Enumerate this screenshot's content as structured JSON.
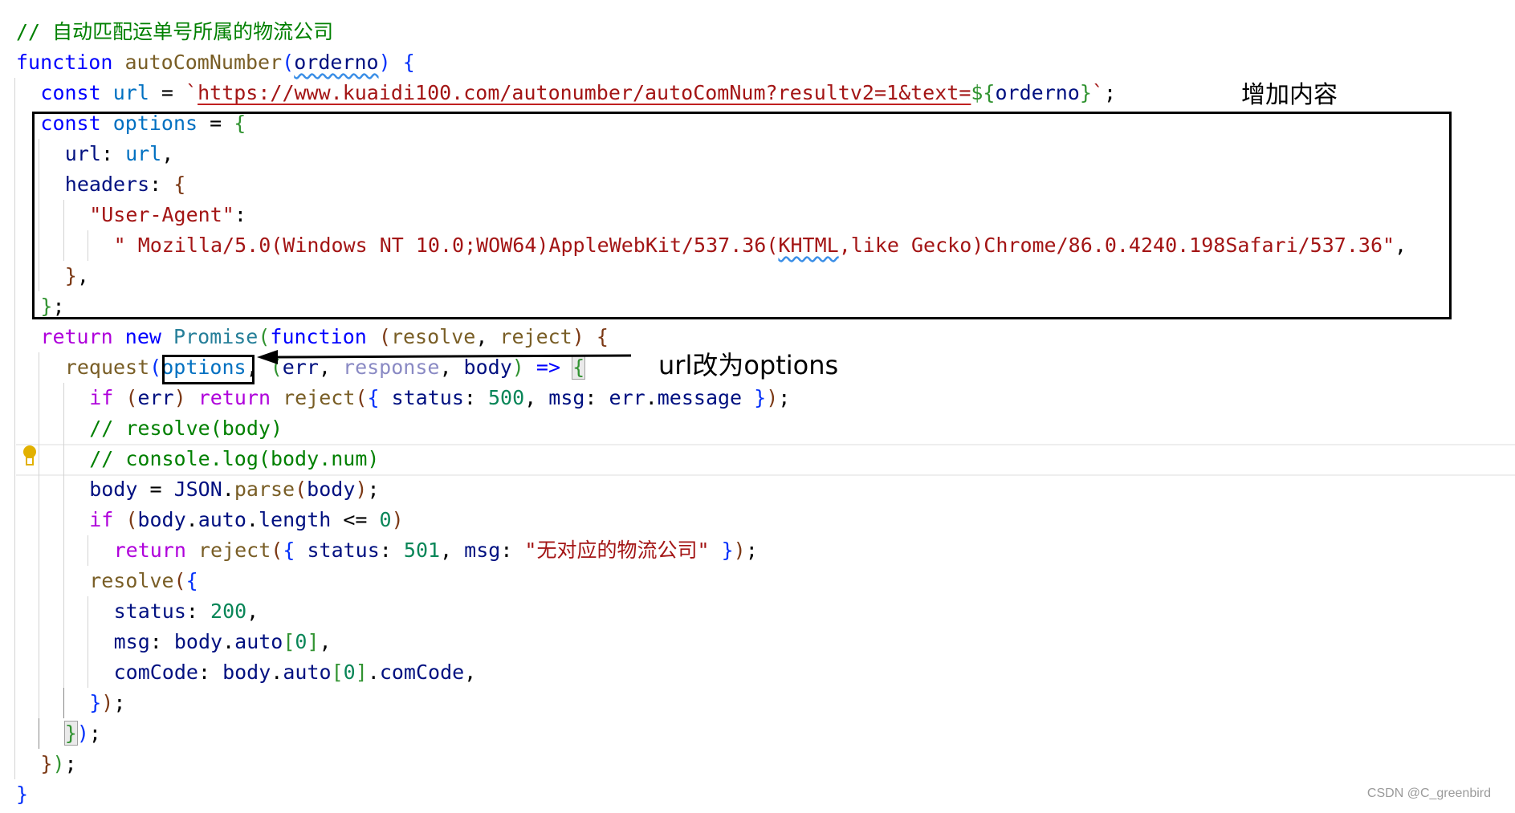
{
  "annotations": {
    "added_content": "增加内容",
    "url_changed": "url改为options"
  },
  "watermark": "CSDN @C_greenbird",
  "icons": {
    "gutter": "lightbulb-icon",
    "arrow": "arrow-left-icon"
  },
  "code": [
    {
      "i": 0,
      "t": [
        [
          "// 自动匹配运单号所属的物流公司",
          "com"
        ]
      ]
    },
    {
      "i": 0,
      "t": [
        [
          "function",
          "kw"
        ],
        [
          " ",
          "pl"
        ],
        [
          "autoComNumber",
          "fn"
        ],
        [
          "(",
          "b1"
        ],
        [
          "orderno",
          "var wavy"
        ],
        [
          ")",
          "b1"
        ],
        [
          " ",
          "pl"
        ],
        [
          "{",
          "b1"
        ]
      ]
    },
    {
      "i": 1,
      "t": [
        [
          "const",
          "kw"
        ],
        [
          " ",
          "pl"
        ],
        [
          "url",
          "opt"
        ],
        [
          " = ",
          "pl"
        ],
        [
          "`",
          "str"
        ],
        [
          "https://www.kuaidi100.com/autonumber/autoComNum?resultv2=1&text=",
          "str redline"
        ],
        [
          "${",
          "b2"
        ],
        [
          "orderno",
          "var"
        ],
        [
          "}",
          "b2"
        ],
        [
          "`",
          "str"
        ],
        [
          ";",
          "pl"
        ]
      ]
    },
    {
      "i": 1,
      "t": [
        [
          "const",
          "kw"
        ],
        [
          " ",
          "pl"
        ],
        [
          "options",
          "opt"
        ],
        [
          " = ",
          "pl"
        ],
        [
          "{",
          "b2"
        ]
      ]
    },
    {
      "i": 2,
      "t": [
        [
          "url",
          "var"
        ],
        [
          ": ",
          "pl"
        ],
        [
          "url",
          "opt"
        ],
        [
          ",",
          "pl"
        ]
      ]
    },
    {
      "i": 2,
      "t": [
        [
          "headers",
          "var"
        ],
        [
          ": ",
          "pl"
        ],
        [
          "{",
          "b3"
        ]
      ]
    },
    {
      "i": 3,
      "t": [
        [
          "\"User-Agent\"",
          "str"
        ],
        [
          ":",
          "pl"
        ]
      ]
    },
    {
      "i": 4,
      "t": [
        [
          "\" Mozilla/5.0(Windows NT 10.0;WOW64)AppleWebKit/537.36(",
          "str"
        ],
        [
          "KHTML",
          "str wavy"
        ],
        [
          ",like Gecko)Chrome/86.0.4240.198Safari/537.36\"",
          "str"
        ],
        [
          ",",
          "pl"
        ]
      ]
    },
    {
      "i": 2,
      "t": [
        [
          "}",
          "b3"
        ],
        [
          ",",
          "pl"
        ]
      ]
    },
    {
      "i": 1,
      "t": [
        [
          "}",
          "b2"
        ],
        [
          ";",
          "pl"
        ]
      ]
    },
    {
      "i": 1,
      "t": [
        [
          "return",
          "ctl"
        ],
        [
          " ",
          "pl"
        ],
        [
          "new",
          "kw"
        ],
        [
          " ",
          "pl"
        ],
        [
          "Promise",
          "type"
        ],
        [
          "(",
          "b2"
        ],
        [
          "function",
          "kw"
        ],
        [
          " ",
          "pl"
        ],
        [
          "(",
          "b3"
        ],
        [
          "resolve",
          "fn"
        ],
        [
          ", ",
          "pl"
        ],
        [
          "reject",
          "fn"
        ],
        [
          ")",
          "b3"
        ],
        [
          " ",
          "pl"
        ],
        [
          "{",
          "b3"
        ]
      ]
    },
    {
      "i": 2,
      "t": [
        [
          "request",
          "fn"
        ],
        [
          "(",
          "b1"
        ],
        [
          "options",
          "opt"
        ],
        [
          ", ",
          "pl"
        ],
        [
          "(",
          "b2"
        ],
        [
          "err",
          "var"
        ],
        [
          ", ",
          "pl"
        ],
        [
          "response",
          "muted"
        ],
        [
          ", ",
          "pl"
        ],
        [
          "body",
          "var"
        ],
        [
          ")",
          "b2"
        ],
        [
          " ",
          "pl"
        ],
        [
          "=>",
          "kw"
        ],
        [
          " ",
          "pl"
        ],
        [
          "{",
          "b2 bracket-box"
        ]
      ]
    },
    {
      "i": 3,
      "t": [
        [
          "if",
          "ctl"
        ],
        [
          " ",
          "pl"
        ],
        [
          "(",
          "b3"
        ],
        [
          "err",
          "var"
        ],
        [
          ")",
          "b3"
        ],
        [
          " ",
          "pl"
        ],
        [
          "return",
          "ctl"
        ],
        [
          " ",
          "pl"
        ],
        [
          "reject",
          "fn"
        ],
        [
          "(",
          "b3"
        ],
        [
          "{",
          "b1"
        ],
        [
          " ",
          "pl"
        ],
        [
          "status",
          "var"
        ],
        [
          ": ",
          "pl"
        ],
        [
          "500",
          "num"
        ],
        [
          ", ",
          "pl"
        ],
        [
          "msg",
          "var"
        ],
        [
          ": ",
          "pl"
        ],
        [
          "err",
          "var"
        ],
        [
          ".",
          "pl"
        ],
        [
          "message",
          "var"
        ],
        [
          " ",
          "pl"
        ],
        [
          "}",
          "b1"
        ],
        [
          ")",
          "b3"
        ],
        [
          ";",
          "pl"
        ]
      ]
    },
    {
      "i": 3,
      "t": [
        [
          "// resolve(body)",
          "com"
        ]
      ]
    },
    {
      "i": 3,
      "t": [
        [
          "// console.log(body.num)",
          "com"
        ]
      ]
    },
    {
      "i": 3,
      "t": [
        [
          "body",
          "var"
        ],
        [
          " = ",
          "pl"
        ],
        [
          "JSON",
          "var"
        ],
        [
          ".",
          "pl"
        ],
        [
          "parse",
          "fn"
        ],
        [
          "(",
          "b3"
        ],
        [
          "body",
          "var"
        ],
        [
          ")",
          "b3"
        ],
        [
          ";",
          "pl"
        ]
      ]
    },
    {
      "i": 3,
      "t": [
        [
          "if",
          "ctl"
        ],
        [
          " ",
          "pl"
        ],
        [
          "(",
          "b3"
        ],
        [
          "body",
          "var"
        ],
        [
          ".",
          "pl"
        ],
        [
          "auto",
          "var"
        ],
        [
          ".",
          "pl"
        ],
        [
          "length",
          "var"
        ],
        [
          " <= ",
          "pl"
        ],
        [
          "0",
          "num"
        ],
        [
          ")",
          "b3"
        ]
      ]
    },
    {
      "i": 4,
      "t": [
        [
          "return",
          "ctl"
        ],
        [
          " ",
          "pl"
        ],
        [
          "reject",
          "fn"
        ],
        [
          "(",
          "b3"
        ],
        [
          "{",
          "b1"
        ],
        [
          " ",
          "pl"
        ],
        [
          "status",
          "var"
        ],
        [
          ": ",
          "pl"
        ],
        [
          "501",
          "num"
        ],
        [
          ", ",
          "pl"
        ],
        [
          "msg",
          "var"
        ],
        [
          ": ",
          "pl"
        ],
        [
          "\"无对应的物流公司\"",
          "str"
        ],
        [
          " ",
          "pl"
        ],
        [
          "}",
          "b1"
        ],
        [
          ")",
          "b3"
        ],
        [
          ";",
          "pl"
        ]
      ]
    },
    {
      "i": 3,
      "t": [
        [
          "resolve",
          "fn"
        ],
        [
          "(",
          "b3"
        ],
        [
          "{",
          "b1"
        ]
      ]
    },
    {
      "i": 4,
      "t": [
        [
          "status",
          "var"
        ],
        [
          ": ",
          "pl"
        ],
        [
          "200",
          "num"
        ],
        [
          ",",
          "pl"
        ]
      ]
    },
    {
      "i": 4,
      "t": [
        [
          "msg",
          "var"
        ],
        [
          ": ",
          "pl"
        ],
        [
          "body",
          "var"
        ],
        [
          ".",
          "pl"
        ],
        [
          "auto",
          "var"
        ],
        [
          "[",
          "b2"
        ],
        [
          "0",
          "num"
        ],
        [
          "]",
          "b2"
        ],
        [
          ",",
          "pl"
        ]
      ]
    },
    {
      "i": 4,
      "t": [
        [
          "comCode",
          "var"
        ],
        [
          ": ",
          "pl"
        ],
        [
          "body",
          "var"
        ],
        [
          ".",
          "pl"
        ],
        [
          "auto",
          "var"
        ],
        [
          "[",
          "b2"
        ],
        [
          "0",
          "num"
        ],
        [
          "]",
          "b2"
        ],
        [
          ".",
          "pl"
        ],
        [
          "comCode",
          "var"
        ],
        [
          ",",
          "pl"
        ]
      ]
    },
    {
      "i": 3,
      "t": [
        [
          "}",
          "b1"
        ],
        [
          ")",
          "b3"
        ],
        [
          ";",
          "pl"
        ]
      ]
    },
    {
      "i": 2,
      "t": [
        [
          "}",
          "b2 bracket-box"
        ],
        [
          ")",
          "b1"
        ],
        [
          ";",
          "pl"
        ]
      ]
    },
    {
      "i": 1,
      "t": [
        [
          "}",
          "b3"
        ],
        [
          ")",
          "b2"
        ],
        [
          ";",
          "pl"
        ]
      ]
    },
    {
      "i": 0,
      "t": [
        [
          "}",
          "b1"
        ]
      ]
    }
  ]
}
